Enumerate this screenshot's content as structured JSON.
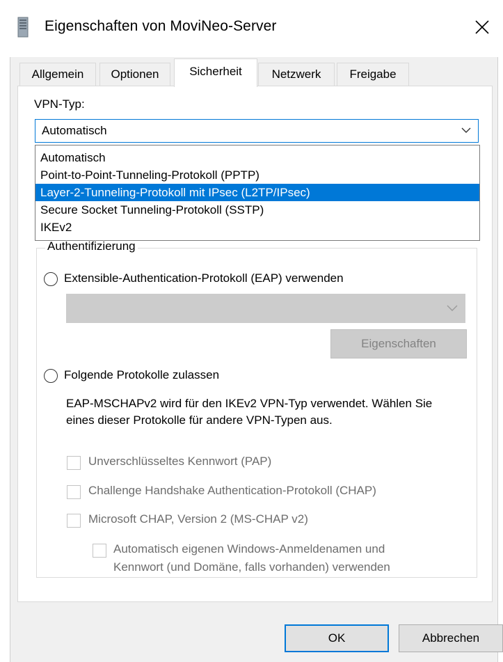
{
  "window": {
    "title": "Eigenschaften von MoviNeo-Server",
    "app_icon": "server-icon",
    "close_icon": "close-icon"
  },
  "tabs": [
    {
      "label": "Allgemein",
      "active": false
    },
    {
      "label": "Optionen",
      "active": false
    },
    {
      "label": "Sicherheit",
      "active": true
    },
    {
      "label": "Netzwerk",
      "active": false
    },
    {
      "label": "Freigabe",
      "active": false
    }
  ],
  "vpn_type": {
    "label": "VPN-Typ:",
    "selected": "Automatisch",
    "options": [
      "Automatisch",
      "Point-to-Point-Tunneling-Protokoll (PPTP)",
      "Layer-2-Tunneling-Protokoll mit IPsec (L2TP/IPsec)",
      "Secure Socket Tunneling-Protokoll (SSTP)",
      "IKEv2"
    ],
    "highlighted_option": "Layer-2-Tunneling-Protokoll mit IPsec (L2TP/IPsec)"
  },
  "auth": {
    "legend": "Authentifizierung",
    "eap_radio_label": "Extensible-Authentication-Protokoll (EAP) verwenden",
    "eap_select_value": "",
    "eap_properties_button": "Eigenschaften",
    "protocols_radio_label": "Folgende Protokolle zulassen",
    "info_text": "EAP-MSCHAPv2 wird für den IKEv2 VPN-Typ verwendet. Wählen Sie eines dieser Protokolle für andere VPN-Typen aus.",
    "checkbox_pap": "Unverschlüsseltes Kennwort (PAP)",
    "checkbox_chap": "Challenge Handshake Authentication-Protokoll (CHAP)",
    "checkbox_mschap": "Microsoft CHAP, Version 2 (MS-CHAP v2)",
    "checkbox_auto_line1": "Automatisch eigenen Windows-Anmeldenamen und",
    "checkbox_auto_line2": "Kennwort (und Domäne, falls vorhanden) verwenden"
  },
  "buttons": {
    "ok": "OK",
    "cancel": "Abbrechen"
  },
  "colors": {
    "accent": "#0078d7",
    "dialog_bg": "#f0f0f0",
    "disabled_text": "#6d6d6d",
    "disabled_fill": "#cccccc"
  }
}
